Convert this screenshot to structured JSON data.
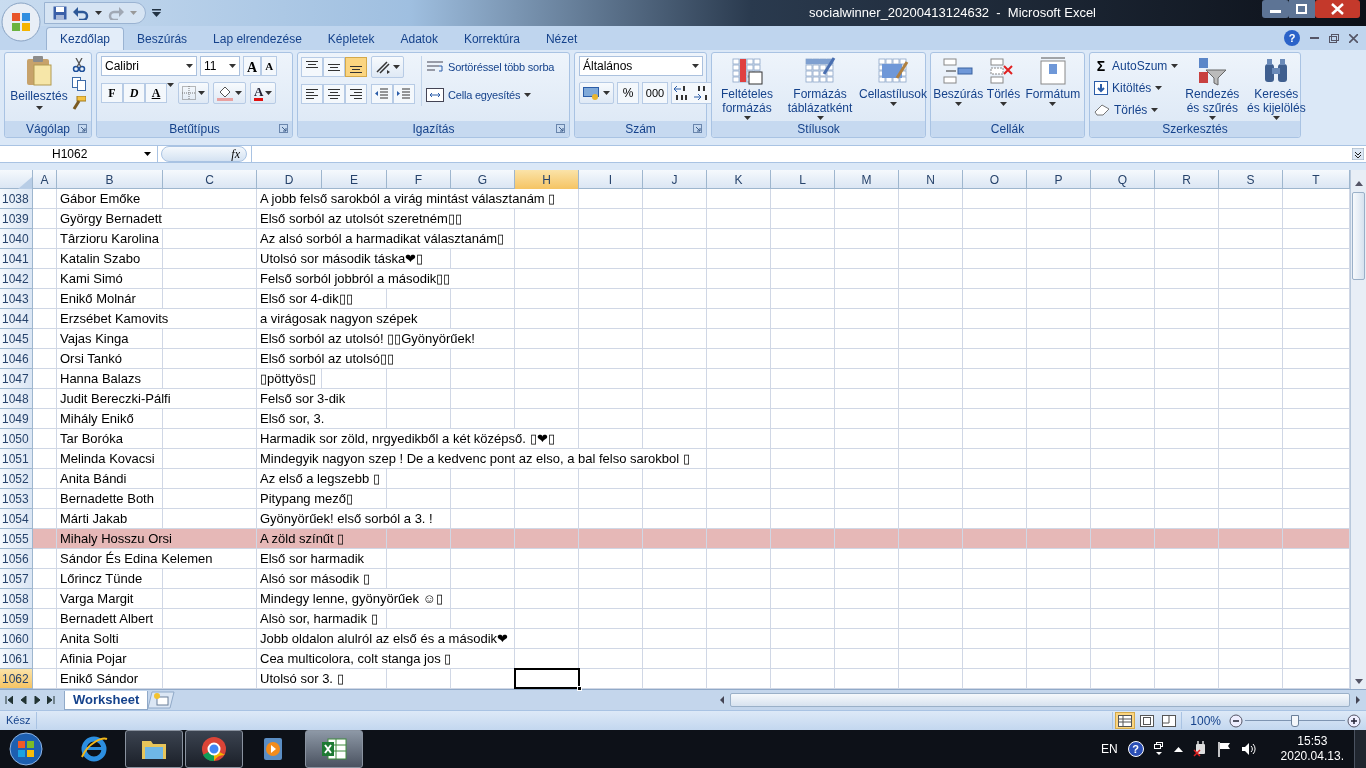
{
  "title_bar": {
    "title": "socialwinner_20200413124632  -  Microsoft Excel",
    "help_glyph": "?"
  },
  "ribbon_tabs": [
    {
      "label": "Kezdőlap",
      "selected": true
    },
    {
      "label": "Beszúrás",
      "selected": false
    },
    {
      "label": "Lap elrendezése",
      "selected": false
    },
    {
      "label": "Képletek",
      "selected": false
    },
    {
      "label": "Adatok",
      "selected": false
    },
    {
      "label": "Korrektúra",
      "selected": false
    },
    {
      "label": "Nézet",
      "selected": false
    }
  ],
  "ribbon": {
    "clipboard": {
      "label": "Vágólap",
      "paste": "Beillesztés"
    },
    "font": {
      "label": "Betűtípus",
      "font_name": "Calibri",
      "font_size": "11",
      "grow": "A",
      "shrink": "A",
      "bold": "F",
      "italic": "D",
      "underline": "A",
      "font_color": "A"
    },
    "alignment": {
      "label": "Igazítás",
      "vertical": [
        {
          "selected": false
        },
        {
          "selected": false
        },
        {
          "selected": true
        }
      ],
      "wrap_text": "Sortöréssel több sorba",
      "merge": "Cella egyesítés"
    },
    "number": {
      "label": "Szám",
      "format": "Általános",
      "percent": "%",
      "thousands": "000"
    },
    "styles": {
      "label": "Stílusok",
      "buttons": [
        "Feltételes formázás",
        "Formázás táblázatként",
        "Cellastílusok"
      ]
    },
    "cells": {
      "label": "Cellák",
      "buttons": [
        "Beszúrás",
        "Törlés",
        "Formátum"
      ]
    },
    "editing": {
      "label": "Szerkesztés",
      "autosum_glyph": "Σ",
      "small_buttons": [
        "AutoSzum",
        "Kitöltés",
        "Törlés"
      ],
      "large_buttons": [
        "Rendezés és szűrés",
        "Keresés és kijelölés"
      ]
    }
  },
  "formula_bar": {
    "name_box": "H1062",
    "function_label": "fx"
  },
  "columns": [
    {
      "label": "A",
      "selected": false
    },
    {
      "label": "B",
      "selected": false
    },
    {
      "label": "C",
      "selected": false
    },
    {
      "label": "D",
      "selected": false
    },
    {
      "label": "E",
      "selected": false
    },
    {
      "label": "F",
      "selected": false
    },
    {
      "label": "G",
      "selected": false
    },
    {
      "label": "H",
      "selected": true
    },
    {
      "label": "I",
      "selected": false
    },
    {
      "label": "J",
      "selected": false
    },
    {
      "label": "K",
      "selected": false
    },
    {
      "label": "L",
      "selected": false
    },
    {
      "label": "M",
      "selected": false
    },
    {
      "label": "N",
      "selected": false
    },
    {
      "label": "O",
      "selected": false
    },
    {
      "label": "P",
      "selected": false
    },
    {
      "label": "Q",
      "selected": false
    },
    {
      "label": "R",
      "selected": false
    },
    {
      "label": "S",
      "selected": false
    },
    {
      "label": "T",
      "selected": false
    }
  ],
  "rows": [
    {
      "number": "1038",
      "name": "Gábor Emőke",
      "comment": "A jobb felső sarokból a virág mintást választanám ▯",
      "highlighted": false,
      "selected": false
    },
    {
      "number": "1039",
      "name": "György Bernadett",
      "comment": "Első sorból az utolsót szeretném▯▯",
      "highlighted": false,
      "selected": false
    },
    {
      "number": "1040",
      "name": "Târzioru Karolina",
      "comment": "Az alsó sorból a harmadikat választanám▯",
      "highlighted": false,
      "selected": false
    },
    {
      "number": "1041",
      "name": "Katalin Szabo",
      "comment": "Utolsó sor második táska❤▯",
      "highlighted": false,
      "selected": false
    },
    {
      "number": "1042",
      "name": "Kami Simó",
      "comment": "Felső sorból jobbról a második▯▯",
      "highlighted": false,
      "selected": false
    },
    {
      "number": "1043",
      "name": "Enikő Molnár",
      "comment": "Első sor 4-dik▯▯",
      "highlighted": false,
      "selected": false
    },
    {
      "number": "1044",
      "name": "Erzsébet Kamovits",
      "comment": "a virágosak nagyon szépek",
      "highlighted": false,
      "selected": false
    },
    {
      "number": "1045",
      "name": "Vajas Kinga",
      "comment": "Első sorból az utolsó! ▯▯Gyönyörűek!",
      "highlighted": false,
      "selected": false
    },
    {
      "number": "1046",
      "name": "Orsi Tankó",
      "comment": "Első sorból az utolsó▯▯",
      "highlighted": false,
      "selected": false
    },
    {
      "number": "1047",
      "name": "Hanna Balazs",
      "comment": "▯pöttyös▯",
      "highlighted": false,
      "selected": false
    },
    {
      "number": "1048",
      "name": "Judit Bereczki-Pálfi",
      "comment": "Felső sor 3-dik",
      "highlighted": false,
      "selected": false
    },
    {
      "number": "1049",
      "name": "Mihály Enikő",
      "comment": "Első sor, 3.",
      "highlighted": false,
      "selected": false
    },
    {
      "number": "1050",
      "name": "Tar Boróka",
      "comment": "Harmadik sor zöld, nrgyedikből a két középső. ▯❤▯",
      "highlighted": false,
      "selected": false
    },
    {
      "number": "1051",
      "name": "Melinda Kovacsi",
      "comment": "Mindegyik nagyon szep ! De a kedvenc pont az elso, a bal felso sarokbol ▯",
      "highlighted": false,
      "selected": false
    },
    {
      "number": "1052",
      "name": "Anita Bándi",
      "comment": "Az első a legszebb ▯",
      "highlighted": false,
      "selected": false
    },
    {
      "number": "1053",
      "name": "Bernadette Both",
      "comment": "Pitypang mező▯",
      "highlighted": false,
      "selected": false
    },
    {
      "number": "1054",
      "name": "Márti Jakab",
      "comment": "Gyönyörűek! első sorból a 3. !",
      "highlighted": false,
      "selected": false
    },
    {
      "number": "1055",
      "name": "Mihaly Hosszu Orsi",
      "comment": "A zöld színűt ▯",
      "highlighted": true,
      "selected": false
    },
    {
      "number": "1056",
      "name": "Sándor És Edina Kelemen",
      "comment": "Első sor harmadik",
      "highlighted": false,
      "selected": false
    },
    {
      "number": "1057",
      "name": "Lőrincz Tünde",
      "comment": "Alsó sor második ▯",
      "highlighted": false,
      "selected": false
    },
    {
      "number": "1058",
      "name": "Varga Margit",
      "comment": "Mindegy lenne, gyönyörűek ☺▯",
      "highlighted": false,
      "selected": false
    },
    {
      "number": "1059",
      "name": "Bernadett Albert",
      "comment": "Alsò sor, harmadik ▯",
      "highlighted": false,
      "selected": false
    },
    {
      "number": "1060",
      "name": "Anita Solti",
      "comment": "Jobb oldalon alulról az első és a második❤",
      "highlighted": false,
      "selected": false
    },
    {
      "number": "1061",
      "name": "Afinia Pojar",
      "comment": "Cea multicolora, colt stanga jos ▯",
      "highlighted": false,
      "selected": false
    },
    {
      "number": "1062",
      "name": "Enikő Sándor",
      "comment": "Utolsó sor 3. ▯",
      "highlighted": false,
      "selected": true
    }
  ],
  "sheet_tabs": [
    {
      "label": "Worksheet",
      "selected": true
    }
  ],
  "status_bar": {
    "status": "Kész",
    "views": [
      {
        "selected": true
      },
      {
        "selected": false
      },
      {
        "selected": false
      }
    ],
    "zoom": "100%",
    "zoom_slider": {
      "level": 0.5
    }
  },
  "taskbar": {
    "apps": [
      {
        "kind": "browser-e",
        "running": false,
        "selected": false
      },
      {
        "kind": "folder",
        "running": true,
        "selected": false
      },
      {
        "kind": "browser-ring",
        "running": true,
        "selected": false
      },
      {
        "kind": "player",
        "running": false,
        "selected": false
      },
      {
        "kind": "spreadsheet",
        "running": true,
        "selected": true
      }
    ],
    "language": "EN",
    "help_glyph": "?",
    "time": "15:53",
    "date": "2020.04.13."
  }
}
